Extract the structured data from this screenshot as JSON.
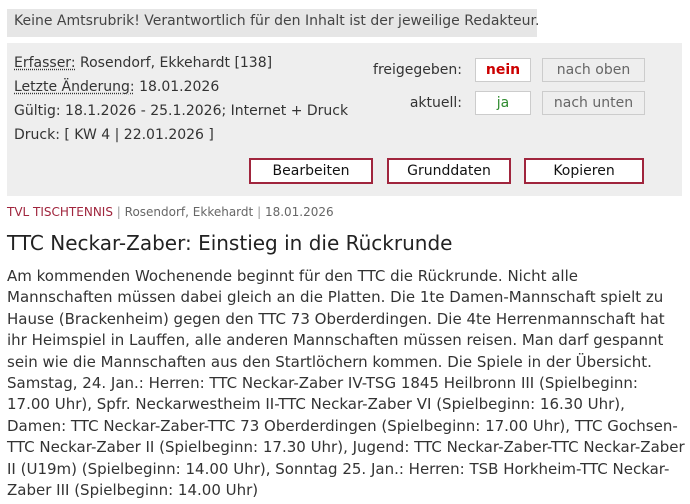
{
  "notice": "Keine Amtsrubrik! Verantwortlich für den Inhalt ist der jeweilige Redakteur.",
  "meta": {
    "author_label": "Erfasser:",
    "author_value": " Rosendorf, Ekkehardt [138]",
    "changed_label": "Letzte Änderung:",
    "changed_value": " 18.01.2026",
    "valid_line": "Gültig: 18.1.2026 - 25.1.2026; Internet + Druck",
    "print_line": "Druck: [ KW 4 | 22.01.2026 ]"
  },
  "status": {
    "released_label": "freigegeben:",
    "released_value": "nein",
    "current_label": "aktuell:",
    "current_value": "ja",
    "move_up": "nach oben",
    "move_down": "nach unten",
    "colors": {
      "nein": "#cc0000",
      "ja": "#2e8b2e"
    }
  },
  "actions": {
    "edit": "Bearbeiten",
    "basedata": "Grunddaten",
    "copy": "Kopieren"
  },
  "article": {
    "category": "TVL TISCHTENNIS",
    "separator": "|",
    "author": "Rosendorf, Ekkehardt",
    "date": "18.01.2026",
    "title": "TTC Neckar-Zaber: Einstieg in die Rückrunde",
    "body": "Am kommenden Wochenende beginnt für den TTC die Rückrunde. Nicht alle Mannschaften müssen dabei gleich an die Platten. Die 1te Damen-Mannschaft spielt zu Hause (Brackenheim) gegen den TTC 73 Oberderdingen. Die 4te Herrenmannschaft hat ihr Heimspiel in Lauffen, alle anderen Mannschaften müssen reisen. Man darf gespannt sein wie die Mannschaften aus den Startlöchern kommen. Die Spiele in der Übersicht. Samstag, 24. Jan.: Herren: TTC Neckar-Zaber IV-TSG 1845 Heilbronn III (Spielbeginn: 17.00 Uhr), Spfr. Neckarwestheim II-TTC Neckar-Zaber VI (Spielbeginn: 16.30 Uhr), Damen: TTC Neckar-Zaber-TTC 73 Oberderdingen (Spielbeginn: 17.00 Uhr), TTC Gochsen-TTC Neckar-Zaber II (Spielbeginn: 17.30 Uhr), Jugend: TTC Neckar-Zaber-TTC Neckar-Zaber II (U19m) (Spielbeginn: 14.00 Uhr), Sonntag 25. Jan.: Herren: TSB Horkheim-TTC Neckar-Zaber III (Spielbeginn: 14.00 Uhr)"
  }
}
